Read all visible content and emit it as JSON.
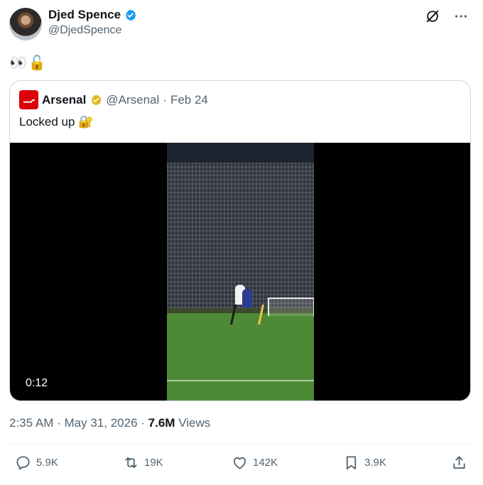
{
  "author": {
    "name": "Djed Spence",
    "handle": "@DjedSpence"
  },
  "tweet_text": "👀🔓",
  "quoted": {
    "name": "Arsenal",
    "handle": "@Arsenal",
    "separator": "·",
    "date": "Feb 24",
    "text": "Locked up 🔐",
    "video_time": "0:12"
  },
  "meta": {
    "time": "2:35 AM",
    "separator1": "·",
    "date": "May 31, 2026",
    "separator2": "·",
    "views_count": "7.6M",
    "views_label": "Views"
  },
  "actions": {
    "replies": "5.9K",
    "reposts": "19K",
    "likes": "142K",
    "bookmarks": "3.9K"
  },
  "colors": {
    "verified_blue": "#1d9bf0",
    "affiliate_gold": "#e2b719",
    "arsenal_red": "#db0007"
  }
}
